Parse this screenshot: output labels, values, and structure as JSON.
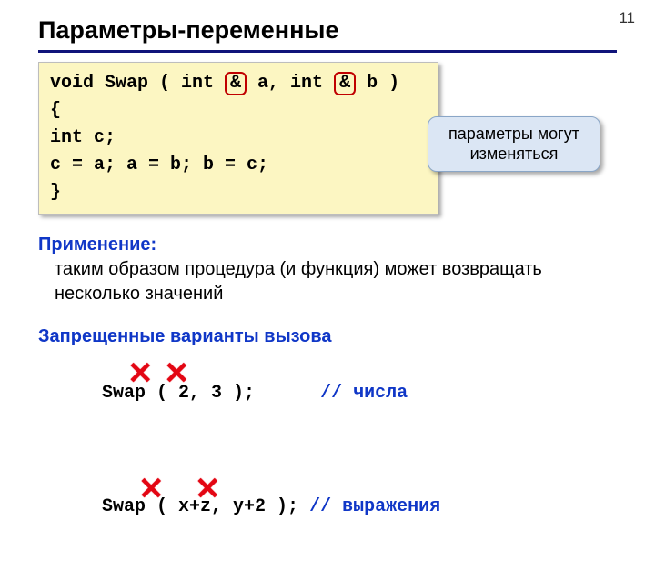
{
  "page_number": "11",
  "title": "Параметры-переменные",
  "code": {
    "sig_pre1": "void Swap ( int ",
    "amp": "&",
    "sig_mid": " a, int ",
    "sig_post": " b )",
    "line2": "{",
    "line3": " int c;",
    "line4": " c = a; a = b; b = c;",
    "line5": "}"
  },
  "callout": "параметры могут изменяться",
  "usage": {
    "lead": "Применение:",
    "text": "таким образом процедура (и функция) может возвращать несколько значений"
  },
  "forbidden_lead": "Запрещенные варианты вызова",
  "bad1": {
    "code": "Swap ( 2, 3 );      ",
    "comment": "// числа"
  },
  "bad2": {
    "code": "Swap ( x+z, y+2 ); ",
    "comment": "// выражения"
  },
  "glyph_x": "✕"
}
